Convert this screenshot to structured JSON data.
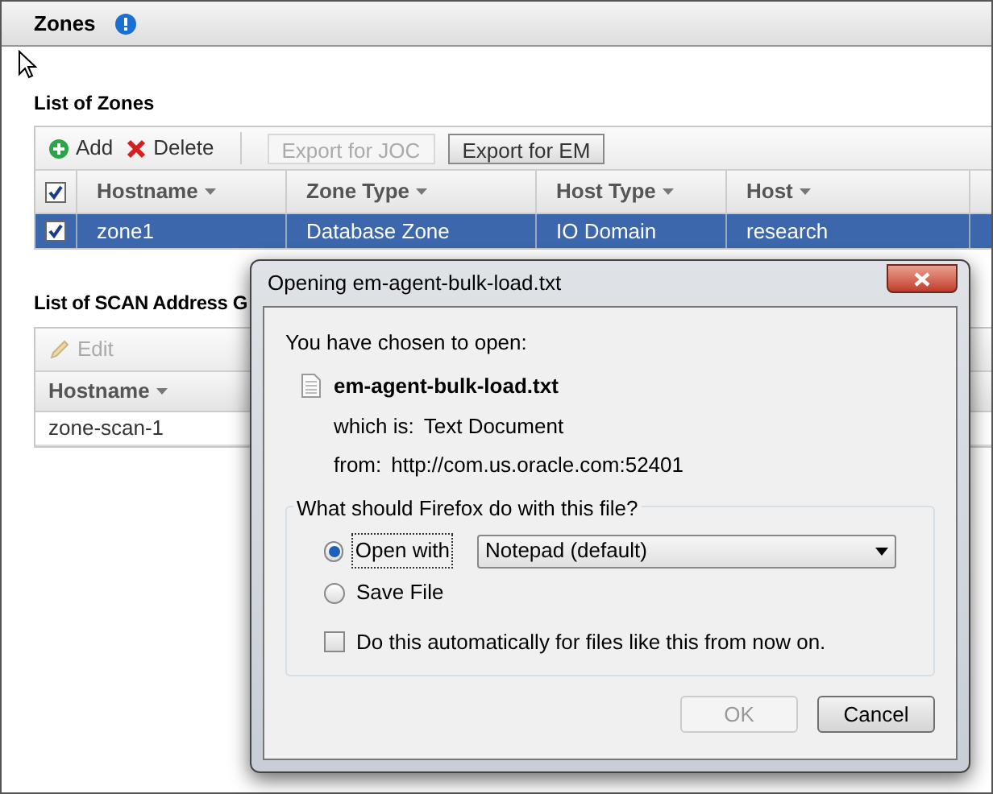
{
  "header": {
    "title": "Zones"
  },
  "zones": {
    "title": "List of Zones",
    "toolbar": [
      {
        "kind": "add",
        "label": "Add",
        "disabled": false
      },
      {
        "kind": "delete",
        "label": "Delete",
        "disabled": false
      },
      {
        "kind": "button",
        "label": "Export for JOC",
        "disabled": true
      },
      {
        "kind": "button",
        "label": "Export for EM",
        "disabled": false
      }
    ],
    "all_checked": true,
    "columns": [
      "Hostname",
      "Zone Type",
      "Host Type",
      "Host"
    ],
    "rows": [
      {
        "checked": true,
        "selected": true,
        "cells": [
          "zone1",
          "Database Zone",
          "IO Domain",
          "research"
        ]
      }
    ]
  },
  "scan": {
    "title": "List of SCAN Address G",
    "toolbar": [
      {
        "kind": "edit",
        "label": "Edit",
        "disabled": true
      }
    ],
    "columns": [
      "Hostname"
    ],
    "rows": [
      {
        "cells": [
          "zone-scan-1"
        ]
      }
    ]
  },
  "dialog": {
    "title": "Opening em-agent-bulk-load.txt",
    "prompt": "You have chosen to open:",
    "filename": "em-agent-bulk-load.txt",
    "details": [
      {
        "label": "which is:",
        "value": "Text Document"
      },
      {
        "label": "from:",
        "value": "http://com.us.oracle.com:52401"
      }
    ],
    "question": "What should Firefox do with this file?",
    "options": [
      {
        "kind": "open",
        "label": "Open with",
        "selected": true
      },
      {
        "kind": "save",
        "label": "Save File",
        "selected": false
      }
    ],
    "application": "Notepad (default)",
    "remember": {
      "label": "Do this automatically for files like this from now on.",
      "checked": false
    },
    "buttons": [
      {
        "label": "OK",
        "disabled": true
      },
      {
        "label": "Cancel",
        "disabled": false
      }
    ]
  }
}
